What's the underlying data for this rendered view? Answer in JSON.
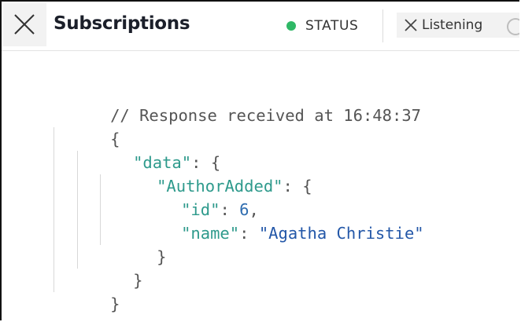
{
  "header": {
    "title": "Subscriptions",
    "status_label": "STATUS",
    "status_color": "#2fb866",
    "listen_label": "Listening",
    "close_icon": "close-icon",
    "listen_icon": "close-icon",
    "spinner_icon": "spinner-icon"
  },
  "response": {
    "comment": "// Response received at 16:48:37",
    "open_root": "{",
    "data_key": "\"data\"",
    "colon": ": ",
    "open_brace": "{",
    "event_key": "\"AuthorAdded\"",
    "id_key": "\"id\"",
    "id_value": "6",
    "comma": ",",
    "name_key": "\"name\"",
    "name_value": "\"Agatha Christie\"",
    "close_inner": "}",
    "close_data": "}",
    "close_root": "}"
  }
}
